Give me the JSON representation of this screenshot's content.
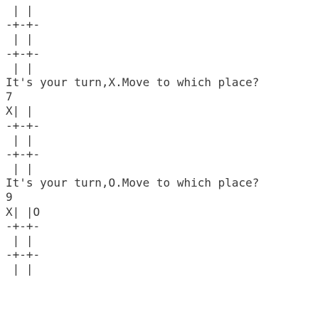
{
  "terminal": {
    "lines": [
      " | |",
      "-+-+-",
      " | |",
      "-+-+-",
      " | |",
      "It's your turn,X.Move to which place?",
      "7",
      "X| |",
      "-+-+-",
      " | |",
      "-+-+-",
      " | |",
      "It's your turn,O.Move to which place?",
      "9",
      "X| |O",
      "-+-+-",
      " | |",
      "-+-+-",
      " | |",
      ""
    ]
  },
  "colors": {
    "background": "#ffffff",
    "text": "#3a3a3a"
  }
}
